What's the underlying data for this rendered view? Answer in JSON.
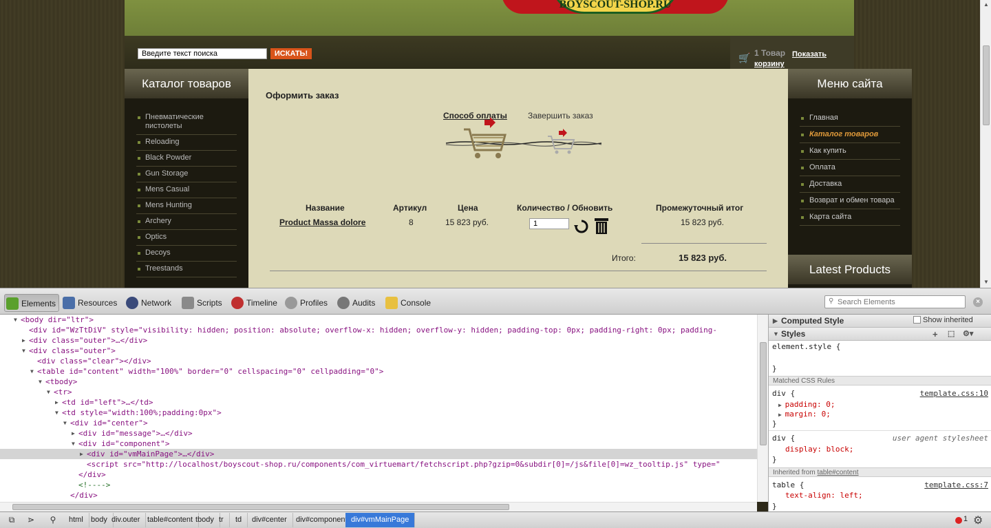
{
  "site": {
    "logo_text": "BOYSCOUT-SHOP.RU",
    "search": {
      "placeholder": "Введите текст поиска",
      "button": "ИСКАТЬ!"
    },
    "cart": {
      "count": "1 Товар",
      "link": "Показать корзину"
    },
    "catalog": {
      "title": "Каталог товаров",
      "items": [
        "Пневматические пистолеты",
        "Reloading",
        "Black Powder",
        "Gun Storage",
        "Mens Casual",
        "Mens Hunting",
        "Archery",
        "Optics",
        "Decoys",
        "Treestands"
      ]
    },
    "menu": {
      "title": "Меню сайта",
      "items": [
        "Главная",
        "Каталог товаров",
        "Как купить",
        "Оплата",
        "Доставка",
        "Возврат и обмен товара",
        "Карта сайта"
      ],
      "active_index": 1
    },
    "latest_title": "Latest Products",
    "order": {
      "title": "Оформить заказ",
      "steps": [
        "Способ оплаты",
        "Завершить заказ"
      ],
      "headers": [
        "Название",
        "Артикул",
        "Цена",
        "Количество / Обновить",
        "Промежуточный итог"
      ],
      "row": {
        "name": "Product Massa dolore",
        "sku": "8",
        "price": "15 823 руб.",
        "qty": "1",
        "subtotal": "15 823 руб."
      },
      "total_label": "Итого:",
      "total_value": "15 823 руб."
    }
  },
  "devtools": {
    "tabs": [
      "Elements",
      "Resources",
      "Network",
      "Scripts",
      "Timeline",
      "Profiles",
      "Audits",
      "Console"
    ],
    "active_tab": "Elements",
    "search_placeholder": "Search Elements",
    "dom_lines": [
      "<body dir=\"ltr\">",
      "<div id=\"WzTtDiV\" style=\"visibility: hidden; position: absolute; overflow-x: hidden; overflow-y: hidden; padding-top: 0px; padding-right: 0px; padding-",
      "<div class=\"outer\">…</div>",
      "<div class=\"outer\">",
      "<div class=\"clear\"></div>",
      "<table id=\"content\" width=\"100%\" border=\"0\" cellspacing=\"0\" cellpadding=\"0\">",
      "<tbody>",
      "<tr>",
      "<td id=\"left\">…</td>",
      "<td style=\"width:100%;padding:0px\">",
      "<div id=\"center\">",
      "<div id=\"message\">…</div>",
      "<div id=\"component\">",
      "<div id=\"vmMainPage\">…</div>",
      "<script src=\"http://localhost/boyscout-shop.ru/components/com_virtuemart/fetchscript.php?gzip=0&subdir[0]=/js&file[0]=wz_tooltip.js\" type=\"",
      "</div>",
      "<!---->",
      "</div>"
    ],
    "styles": {
      "computed_label": "Computed Style",
      "show_inherited": "Show inherited",
      "styles_label": "Styles",
      "element_style": "element.style {",
      "close_brace": "}",
      "matched_label": "Matched CSS Rules",
      "rule1_selector": "div {",
      "rule1_src": "template.css:10",
      "rule1_props": [
        "padding: 0;",
        "margin: 0;"
      ],
      "rule2_selector": "div {",
      "rule2_src": "user agent stylesheet",
      "rule2_prop": "display: block;",
      "inherited_label": "Inherited from",
      "inherited_from": "table#content",
      "rule3_selector": "table {",
      "rule3_src": "template.css:7",
      "rule3_prop": "text-align: left;"
    },
    "breadcrumbs": [
      "html",
      "body",
      "div.outer",
      "table#content",
      "tbody",
      "tr",
      "td",
      "div#center",
      "div#component",
      "div#vmMainPage"
    ],
    "error_count": "1"
  }
}
